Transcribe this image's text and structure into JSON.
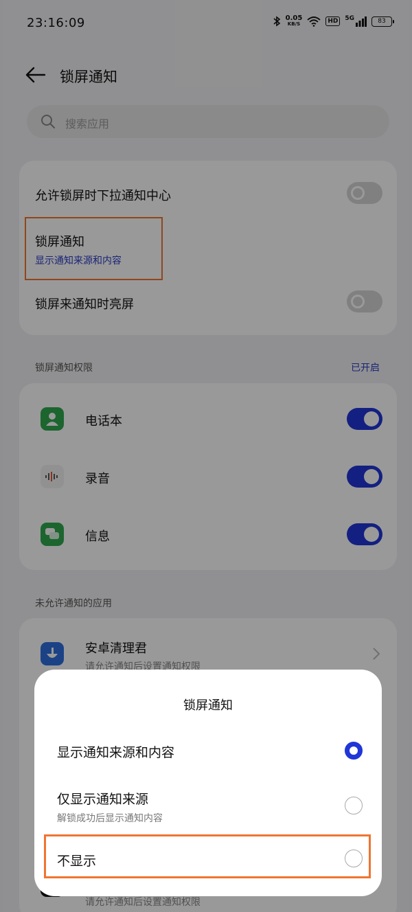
{
  "status_bar": {
    "time": "23:16:09",
    "speed_value": "0.05",
    "speed_unit": "KB/S",
    "hd": "HD",
    "signal": "5G",
    "battery": "83"
  },
  "header": {
    "title": "锁屏通知"
  },
  "search": {
    "placeholder": "搜索应用"
  },
  "settings_card": {
    "pull_down": "允许锁屏时下拉通知中心",
    "lock_notify": "锁屏通知",
    "lock_notify_value": "显示通知来源和内容",
    "wake": "锁屏来通知时亮屏"
  },
  "permissions": {
    "section_title": "锁屏通知权限",
    "section_status": "已开启",
    "apps": [
      {
        "name": "电话本",
        "icon": "contacts-icon",
        "color": "#2fa84f",
        "enabled": true
      },
      {
        "name": "录音",
        "icon": "recorder-icon",
        "color": "#f2f2f4",
        "enabled": true
      },
      {
        "name": "信息",
        "icon": "messages-icon",
        "color": "#2fa84f",
        "enabled": true
      }
    ]
  },
  "not_allowed": {
    "section_title": "未允许通知的应用",
    "app_name": "安卓清理君",
    "app_sub": "请允许通知后设置通知权限",
    "app2_sub": "请允许通知后设置通知权限"
  },
  "dialog": {
    "title": "锁屏通知",
    "option_show_all": "显示通知来源和内容",
    "option_source_only": "仅显示通知来源",
    "option_source_only_sub": "解锁成功后显示通知内容",
    "option_hide": "不显示",
    "selected": "显示通知来源和内容"
  },
  "colors": {
    "accent": "#2036d7",
    "highlight": "#f07430"
  }
}
